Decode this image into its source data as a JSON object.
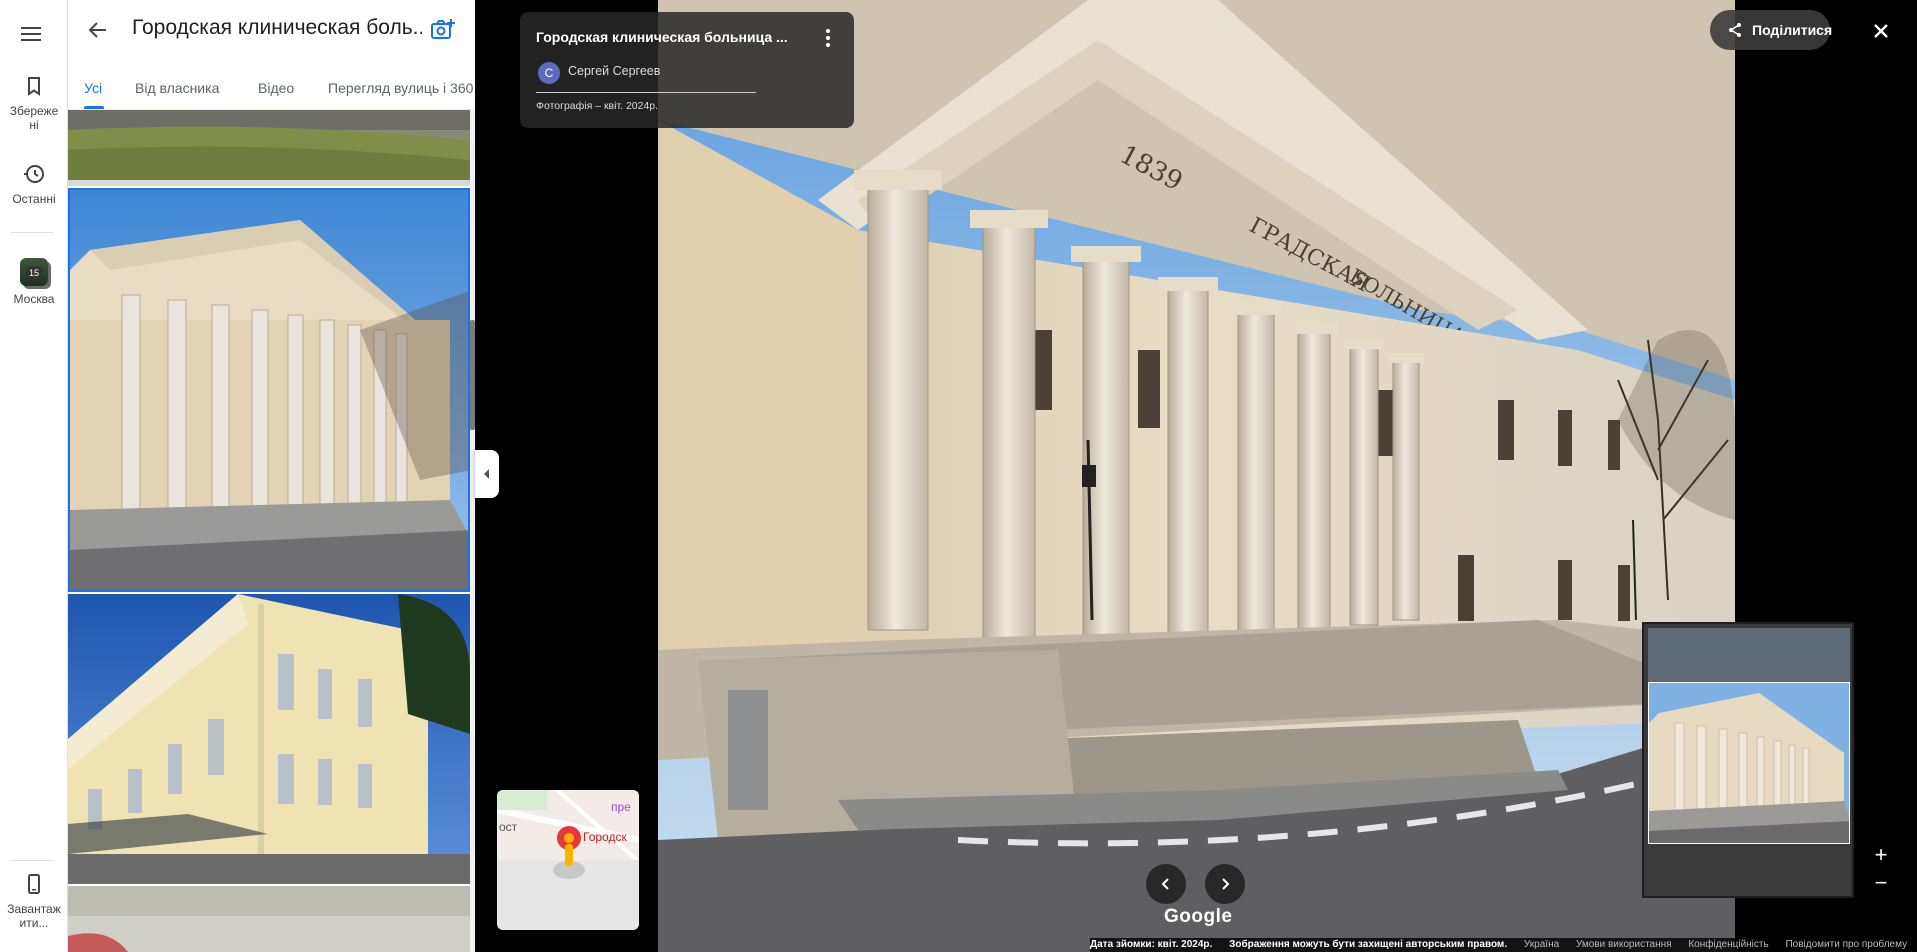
{
  "rail": {
    "saved_label": "Збережені",
    "recent_label": "Останні",
    "moscow_label": "Москва",
    "moscow_badge": "15",
    "download_label": "Завантажити..."
  },
  "panel": {
    "title": "Городская клинич­еская боль...",
    "tabs": [
      {
        "label": "Усі",
        "active": true
      },
      {
        "label": "Від власника",
        "active": false
      },
      {
        "label": "Відео",
        "active": false
      },
      {
        "label": "Перегляд вулиць і 360",
        "active": false
      }
    ]
  },
  "viewer": {
    "info": {
      "title": "Городская клиническая больница ...",
      "avatar_letter": "С",
      "author": "Сергей Сергеев",
      "date": "Фотографія – квіт. 2024р."
    },
    "share_label": "Поділитися",
    "google_logo": "Google",
    "minimap": {
      "label_pre": "пре",
      "label_ost": "ост",
      "label_place": "Городск"
    },
    "footer": {
      "date": "Дата зйомки: квіт. 2024р.",
      "copyright": "Зображення можуть бути захищені авторським правом.",
      "country": "Україна",
      "terms": "Умови використання",
      "privacy": "Конфіденційність",
      "report": "Повідомити про проблему"
    }
  },
  "colors": {
    "accent": "#1a73e8",
    "avatar": "#5c6bc0"
  }
}
